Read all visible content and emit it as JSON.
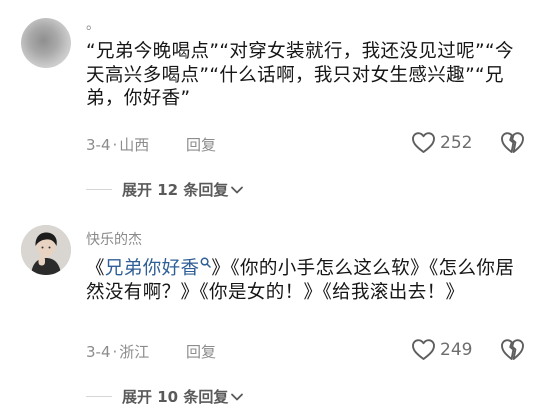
{
  "comments": [
    {
      "username": "。",
      "text": "“兄弟今晚喝点”“对穿女装就行，我还没见过呢”“今天高兴多喝点”“什么话啊，我只对女生感兴趣”“兄弟，你好香”",
      "date": "3-4",
      "location": "山西",
      "reply_label": "回复",
      "likes": "252",
      "expand_label": "展开 12 条回复"
    },
    {
      "username": "快乐的杰",
      "text_prefix": "《",
      "text_link": "兄弟你好香",
      "text_rest": "》《你的小手怎么这么软》《怎么你居然没有啊？》《你是女的！》《给我滚出去！》",
      "date": "3-4",
      "location": "浙江",
      "reply_label": "回复",
      "likes": "249",
      "expand_label": "展开 10 条回复"
    }
  ],
  "colors": {
    "link": "#2f5f96",
    "meta": "#8c8c8c",
    "text": "#161616"
  },
  "icons": [
    "heart-icon",
    "broken-heart-icon",
    "search-icon",
    "chevron-down-icon"
  ]
}
